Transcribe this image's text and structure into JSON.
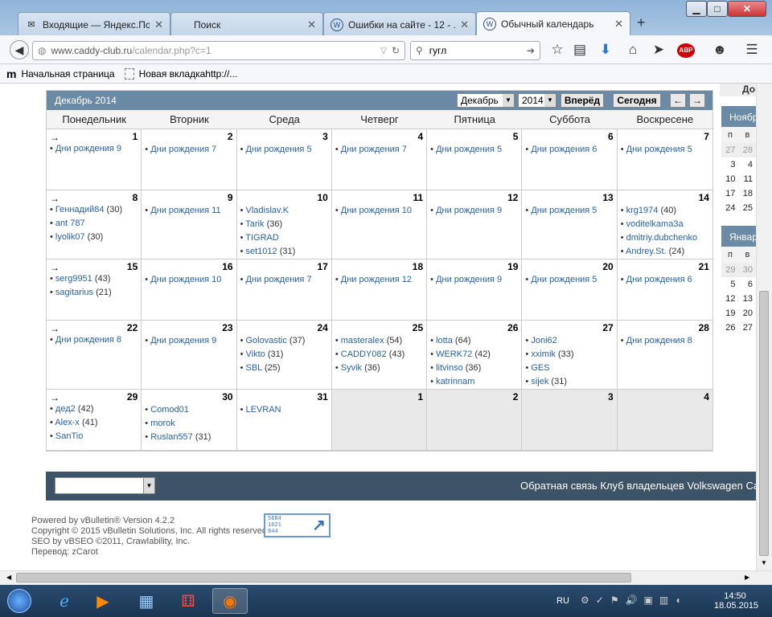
{
  "browser": {
    "tabs": [
      {
        "title": "Входящие — Яндекс.По...",
        "icon": "mail-icon"
      },
      {
        "title": "Поиск",
        "icon": ""
      },
      {
        "title": "Ошибки на сайте - 12 - ...",
        "icon": "vw-logo-icon"
      },
      {
        "title": "Обычный календарь",
        "icon": "vw-logo-icon",
        "active": true
      }
    ],
    "url_domain": "www.caddy-club.ru",
    "url_path": "/calendar.php?c=1",
    "search_value": "гугл",
    "bookmarks": [
      {
        "label": "Начальная страница",
        "icon": "m-logo-icon"
      },
      {
        "label": "Новая вкладкаhttp://...",
        "icon": "page-icon"
      }
    ]
  },
  "calendar": {
    "title": "Декабрь 2014",
    "month_select": "Декабрь",
    "year_select": "2014",
    "forward_label": "Вперёд",
    "today_label": "Сегодня",
    "prev_arrow": "←",
    "next_arrow": "→",
    "weekdays": [
      "Понедельник",
      "Вторник",
      "Среда",
      "Четверг",
      "Пятница",
      "Суббота",
      "Воскресене"
    ],
    "weeks": [
      [
        {
          "day": "1",
          "arrow": "→",
          "items": [
            {
              "name": "Дни рождения 9"
            }
          ]
        },
        {
          "day": "2",
          "items": [
            {
              "name": "Дни рождения 7"
            }
          ]
        },
        {
          "day": "3",
          "items": [
            {
              "name": "Дни рождения 5"
            }
          ]
        },
        {
          "day": "4",
          "items": [
            {
              "name": "Дни рождения 7"
            }
          ]
        },
        {
          "day": "5",
          "items": [
            {
              "name": "Дни рождения 5"
            }
          ]
        },
        {
          "day": "6",
          "items": [
            {
              "name": "Дни рождения 6"
            }
          ]
        },
        {
          "day": "7",
          "items": [
            {
              "name": "Дни рождения 5"
            }
          ]
        }
      ],
      [
        {
          "day": "8",
          "arrow": "→",
          "items": [
            {
              "name": "Геннадий84",
              "age": "(30)"
            },
            {
              "name": "ant 787"
            },
            {
              "name": "lyolik07",
              "age": "(30)"
            }
          ]
        },
        {
          "day": "9",
          "items": [
            {
              "name": "Дни рождения 11"
            }
          ]
        },
        {
          "day": "10",
          "items": [
            {
              "name": "Vladislav.K"
            },
            {
              "name": "Tarik",
              "age": "(36)"
            },
            {
              "name": "TIGRAD"
            },
            {
              "name": "set1012",
              "age": "(31)"
            }
          ]
        },
        {
          "day": "11",
          "items": [
            {
              "name": "Дни рождения 10"
            }
          ]
        },
        {
          "day": "12",
          "items": [
            {
              "name": "Дни рождения 9"
            }
          ]
        },
        {
          "day": "13",
          "items": [
            {
              "name": "Дни рождения 5"
            }
          ]
        },
        {
          "day": "14",
          "items": [
            {
              "name": "krg1974",
              "age": "(40)"
            },
            {
              "name": "voditelkama3a"
            },
            {
              "name": "dmitriy.dubchenko"
            },
            {
              "name": "Andrey.St.",
              "age": "(24)"
            }
          ]
        }
      ],
      [
        {
          "day": "15",
          "arrow": "→",
          "items": [
            {
              "name": "serg9951",
              "age": "(43)"
            },
            {
              "name": "sagitarius",
              "age": "(21)"
            }
          ]
        },
        {
          "day": "16",
          "items": [
            {
              "name": "Дни рождения 10"
            }
          ]
        },
        {
          "day": "17",
          "items": [
            {
              "name": "Дни рождения 7"
            }
          ]
        },
        {
          "day": "18",
          "items": [
            {
              "name": "Дни рождения 12"
            }
          ]
        },
        {
          "day": "19",
          "items": [
            {
              "name": "Дни рождения 9"
            }
          ]
        },
        {
          "day": "20",
          "items": [
            {
              "name": "Дни рождения 5"
            }
          ]
        },
        {
          "day": "21",
          "items": [
            {
              "name": "Дни рождения 6"
            }
          ]
        }
      ],
      [
        {
          "day": "22",
          "arrow": "→",
          "items": [
            {
              "name": "Дни рождения 8"
            }
          ]
        },
        {
          "day": "23",
          "items": [
            {
              "name": "Дни рождения 9"
            }
          ]
        },
        {
          "day": "24",
          "items": [
            {
              "name": "Golovastic",
              "age": "(37)"
            },
            {
              "name": "Vikto",
              "age": "(31)"
            },
            {
              "name": "SBL",
              "age": "(25)"
            }
          ]
        },
        {
          "day": "25",
          "items": [
            {
              "name": "masteralex",
              "age": "(54)"
            },
            {
              "name": "CADDY082",
              "age": "(43)"
            },
            {
              "name": "Syvik",
              "age": "(36)"
            }
          ]
        },
        {
          "day": "26",
          "items": [
            {
              "name": "lotta",
              "age": "(64)"
            },
            {
              "name": "WERK72",
              "age": "(42)"
            },
            {
              "name": "litvinso",
              "age": "(36)"
            },
            {
              "name": "katrinnam"
            }
          ]
        },
        {
          "day": "27",
          "items": [
            {
              "name": "Joni62"
            },
            {
              "name": "xximik",
              "age": "(33)"
            },
            {
              "name": "GES"
            },
            {
              "name": "sijek",
              "age": "(31)"
            }
          ]
        },
        {
          "day": "28",
          "items": [
            {
              "name": "Дни рождения 8"
            }
          ]
        }
      ],
      [
        {
          "day": "29",
          "arrow": "→",
          "items": [
            {
              "name": "дед2",
              "age": "(42)"
            },
            {
              "name": "Alex-x",
              "age": "(41)"
            },
            {
              "name": "SanTio"
            }
          ]
        },
        {
          "day": "30",
          "items": [
            {
              "name": "Comod01"
            },
            {
              "name": "morok"
            },
            {
              "name": "Ruslan557",
              "age": "(31)"
            }
          ]
        },
        {
          "day": "31",
          "items": [
            {
              "name": "LEVRAN"
            }
          ]
        },
        {
          "day": "1",
          "other": true,
          "items": []
        },
        {
          "day": "2",
          "other": true,
          "items": []
        },
        {
          "day": "3",
          "other": true,
          "items": []
        },
        {
          "day": "4",
          "other": true,
          "items": []
        }
      ]
    ]
  },
  "side": {
    "top_label": "До",
    "nov_label": "Ноябр",
    "nov_head": [
      "п",
      "в"
    ],
    "nov_rows": [
      [
        "27",
        "28"
      ],
      [
        "3",
        "4"
      ],
      [
        "10",
        "11"
      ],
      [
        "17",
        "18"
      ],
      [
        "24",
        "25"
      ]
    ],
    "jan_label": "Январ",
    "jan_head": [
      "п",
      "в"
    ],
    "jan_rows": [
      [
        "29",
        "30"
      ],
      [
        "5",
        "6"
      ],
      [
        "12",
        "13"
      ],
      [
        "19",
        "20"
      ],
      [
        "26",
        "27"
      ]
    ]
  },
  "footer": {
    "links": "Обратная связь   Клуб владельцев Volkswagen Caddy",
    "powered": [
      "Powered by vBulletin® Version 4.2.2",
      "Copyright © 2015 vBulletin Solutions, Inc. All rights reserved.",
      "SEO by vBSEO ©2011, Crawlability, Inc.",
      "Перевод: zCarot"
    ],
    "badge_lines": [
      "5684",
      "1621",
      "844"
    ]
  },
  "taskbar": {
    "lang": "RU",
    "time": "14:50",
    "date": "18.05.2015"
  }
}
